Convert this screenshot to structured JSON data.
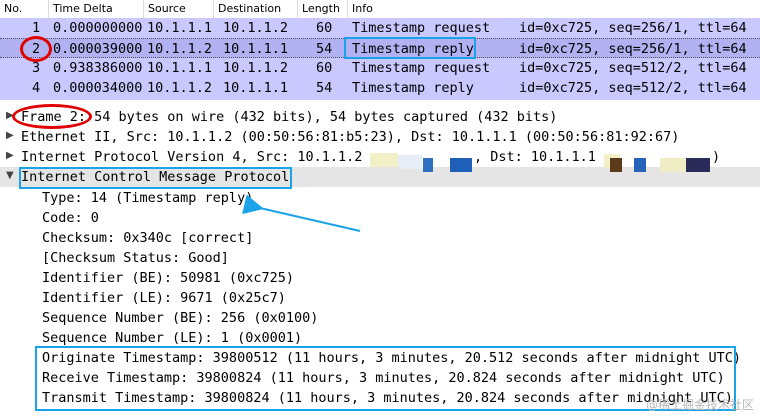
{
  "packet_list": {
    "columns": [
      "No.",
      "Time Delta",
      "Source",
      "Destination",
      "Length",
      "Info"
    ],
    "rows": [
      {
        "no": "1",
        "delta": "0.000000000",
        "src": "10.1.1.1",
        "dst": "10.1.1.2",
        "len": "60",
        "info": "Timestamp request",
        "ids": "id=0xc725, seq=256/1, ttl=64"
      },
      {
        "no": "2",
        "delta": "0.000039000",
        "src": "10.1.1.2",
        "dst": "10.1.1.1",
        "len": "54",
        "info": "Timestamp reply",
        "ids": "id=0xc725, seq=256/1, ttl=64"
      },
      {
        "no": "3",
        "delta": "0.938386000",
        "src": "10.1.1.1",
        "dst": "10.1.1.2",
        "len": "60",
        "info": "Timestamp request",
        "ids": "id=0xc725, seq=512/2, ttl=64"
      },
      {
        "no": "4",
        "delta": "0.000034000",
        "src": "10.1.1.2",
        "dst": "10.1.1.1",
        "len": "54",
        "info": "Timestamp reply",
        "ids": "id=0xc725, seq=512/2, ttl=64"
      }
    ]
  },
  "details": {
    "frame": {
      "label": "Frame 2:",
      "rest": " 54 bytes on wire (432 bits), 54 bytes captured (432 bits)"
    },
    "ethernet": "Ethernet II, Src: 10.1.1.2 (00:50:56:81:b5:23), Dst: 10.1.1.1 (00:50:56:81:92:67)",
    "ip_prefix": "Internet Protocol Version 4, Src: 10.1.1.2",
    "ip_mid": ", Dst: 10.1.1.1",
    "ip_suffix": ")",
    "icmp": "Internet Control Message Protocol",
    "fields": [
      "Type: 14 (Timestamp reply)",
      "Code: 0",
      "Checksum: 0x340c [correct]",
      "[Checksum Status: Good]",
      "Identifier (BE): 50981 (0xc725)",
      "Identifier (LE): 9671 (0x25c7)",
      "Sequence Number (BE): 256 (0x0100)",
      "Sequence Number (LE): 1 (0x0001)",
      "Originate Timestamp: 39800512 (11 hours, 3 minutes, 20.512 seconds after midnight UTC)",
      "Receive Timestamp: 39800824 (11 hours, 3 minutes, 20.824 seconds after midnight UTC)",
      "Transmit Timestamp: 39800824 (11 hours, 3 minutes, 20.824 seconds after midnight UTC)"
    ]
  },
  "colors": {
    "row_bg": "#c9c9ff",
    "selected_row_bg": "#b2b2f2",
    "annotation_blue": "#1aa3e8",
    "annotation_red": "#e00000"
  },
  "watermark": "@稀土掘金技术社区"
}
